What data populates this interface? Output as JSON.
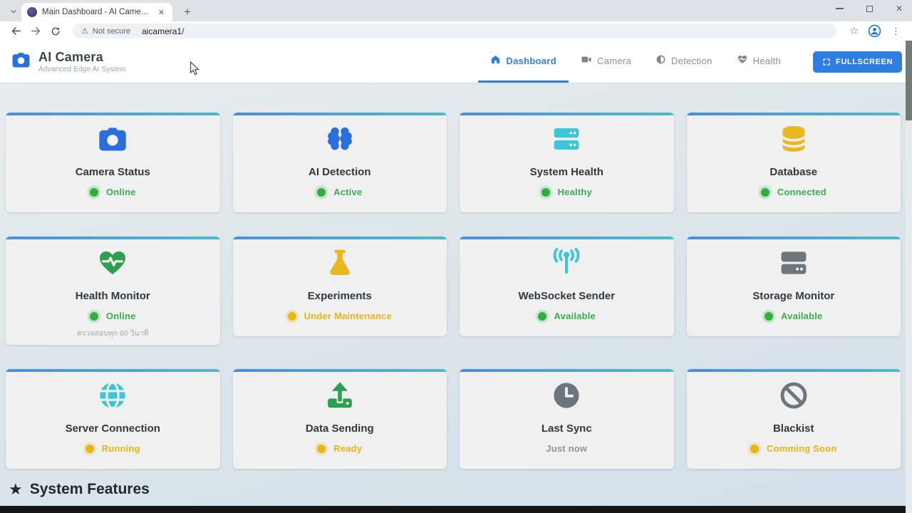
{
  "browser": {
    "tab": {
      "title": "Main Dashboard - AI Camera v...",
      "close_glyph": "✕",
      "new_tab_glyph": "+"
    },
    "window_controls": {
      "close_glyph": "✕"
    },
    "toolbar": {
      "warning_glyph": "⚠",
      "not_secure_label": "Not secure",
      "url": "aicamera1/",
      "bookmark_glyph": "☆",
      "menu_glyph": "⋮"
    }
  },
  "header": {
    "app_name": "AI Camera",
    "app_subtitle": "Advanced Edge AI System",
    "nav_items": [
      {
        "label": "Dashboard",
        "active": true
      },
      {
        "label": "Camera",
        "active": false
      },
      {
        "label": "Detection",
        "active": false
      },
      {
        "label": "Health",
        "active": false
      }
    ],
    "fullscreen_label": "FULLSCREEN"
  },
  "cards": [
    {
      "title": "Camera Status",
      "icon": "camera",
      "icon_color": "#2b6fdd",
      "status": "Online",
      "status_color": "green",
      "has_dot": true
    },
    {
      "title": "AI Detection",
      "icon": "brain",
      "icon_color": "#2b6fdd",
      "status": "Active",
      "status_color": "green",
      "has_dot": true
    },
    {
      "title": "System Health",
      "icon": "server",
      "icon_color": "#3ec6d8",
      "status": "Healthy",
      "status_color": "green",
      "has_dot": true
    },
    {
      "title": "Database",
      "icon": "database",
      "icon_color": "#e8b821",
      "status": "Connected",
      "status_color": "green",
      "has_dot": true
    },
    {
      "title": "Health Monitor",
      "icon": "heart-pulse",
      "icon_color": "#2e9e50",
      "status": "Online",
      "status_color": "green",
      "has_dot": true,
      "note": "ตรวจสอบทุก 60 วินาที"
    },
    {
      "title": "Experiments",
      "icon": "flask",
      "icon_color": "#e8b821",
      "status": "Under Maintenance",
      "status_color": "yellow",
      "has_dot": true
    },
    {
      "title": "WebSocket Sender",
      "icon": "broadcast",
      "icon_color": "#3ec6d8",
      "status": "Available",
      "status_color": "green",
      "has_dot": true
    },
    {
      "title": "Storage Monitor",
      "icon": "hdd",
      "icon_color": "#6d757d",
      "status": "Available",
      "status_color": "green",
      "has_dot": true
    },
    {
      "title": "Server Connection",
      "icon": "globe",
      "icon_color": "#3ec6d8",
      "status": "Running",
      "status_color": "yellow",
      "has_dot": true
    },
    {
      "title": "Data Sending",
      "icon": "upload",
      "icon_color": "#2e9e50",
      "status": "Ready",
      "status_color": "yellow",
      "has_dot": true
    },
    {
      "title": "Last Sync",
      "icon": "clock",
      "icon_color": "#6d757d",
      "status": "Just now",
      "status_color": "gray",
      "has_dot": false
    },
    {
      "title": "Blackist",
      "icon": "ban",
      "icon_color": "#6d757d",
      "status": "Comming Soon",
      "status_color": "yellow",
      "has_dot": true
    }
  ],
  "features_section": {
    "heading": "System Features",
    "star_glyph": "★"
  },
  "colors": {
    "accent_blue": "#2e7de0",
    "icon_blue": "#2b6fdd",
    "teal": "#3ec6d8",
    "gold": "#e8b821",
    "green_icon": "#2e9e50",
    "gray_icon": "#6d757d",
    "status_green": "#39ad53",
    "status_yellow": "#e7b51c",
    "status_gray": "#8d9499",
    "card_strip_left": "#4d8ed8",
    "card_strip_right": "#4fb9c8"
  }
}
